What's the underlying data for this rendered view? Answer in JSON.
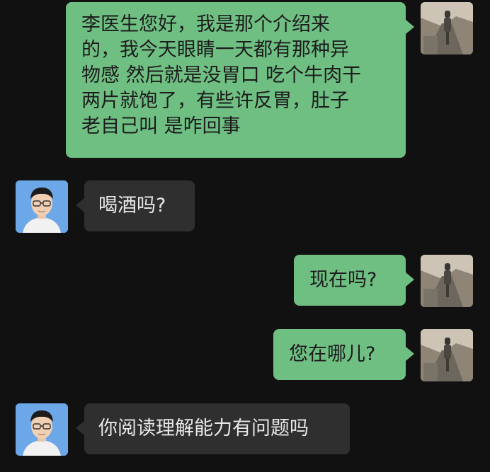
{
  "colors": {
    "background": "#111111",
    "outgoing_bubble": "#6fbf83",
    "incoming_bubble": "#2f2f2f",
    "incoming_text": "#e8e8e8",
    "outgoing_text": "#1c1c1c"
  },
  "messages": [
    {
      "direction": "outgoing",
      "text": "李医生您好，我是那个介绍来\n的，我今天眼睛一天都有那种异\n物感 然后就是没胃口 吃个牛肉干\n两片就饱了，有些许反胃，肚子\n老自己叫 是咋回事"
    },
    {
      "direction": "incoming",
      "text": "喝酒吗?"
    },
    {
      "direction": "outgoing",
      "text": "现在吗?"
    },
    {
      "direction": "outgoing",
      "text": "您在哪儿?"
    },
    {
      "direction": "incoming",
      "text": "你阅读理解能力有问题吗"
    }
  ]
}
